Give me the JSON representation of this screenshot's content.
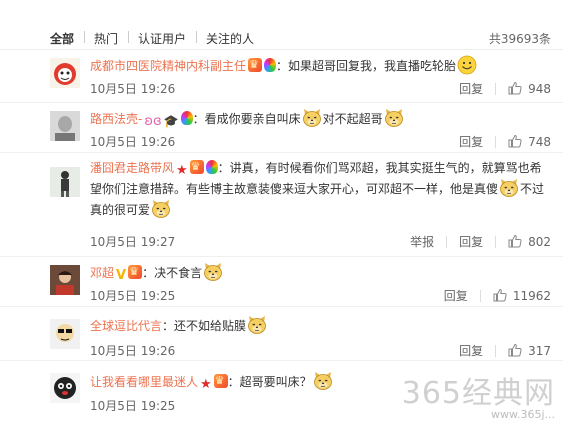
{
  "tabs": {
    "all": "全部",
    "hot": "热门",
    "verified": "认证用户",
    "following": "关注的人",
    "total": "共39693条"
  },
  "comments": [
    {
      "username": "成都市四医院精神内科副主任",
      "text": "：如果超哥回复我，我直播吃轮胎",
      "date": "10月5日 19:26",
      "reply": "回复",
      "likes": "948"
    },
    {
      "username": "路西法壳-",
      "text_a": "：看成你要亲自叫床",
      "text_b": "对不起超哥",
      "date": "10月5日 19:26",
      "reply": "回复",
      "likes": "748"
    },
    {
      "username": "潘囧君走路带风",
      "line1": "：讲真，有时候看你们骂邓超，我其实挺生气的，就算骂也希",
      "line2": "望你们注意措辞。有些博主故意装傻来逗大家开心，可邓超不一样，他是真傻",
      "line2b": "不过",
      "line3": "真的很可爱",
      "date": "10月5日 19:27",
      "report": "举报",
      "reply": "回复",
      "likes": "802"
    },
    {
      "username": "邓超",
      "text": "：决不食言",
      "date": "10月5日 19:25",
      "reply": "回复",
      "likes": "11962"
    },
    {
      "username": "全球逗比代言",
      "text": "：还不如给贴膜",
      "date": "10月5日 19:26",
      "reply": "回复",
      "likes": "317"
    },
    {
      "username": "让我看看哪里最迷人",
      "text": "：超哥要叫床？",
      "date": "10月5日 19:25"
    }
  ],
  "watermark": {
    "main": "365经典网",
    "url": "www.365j..."
  },
  "colors": {
    "username": "#eb7350",
    "meta": "#666666",
    "divider": "#f0f0f0"
  }
}
